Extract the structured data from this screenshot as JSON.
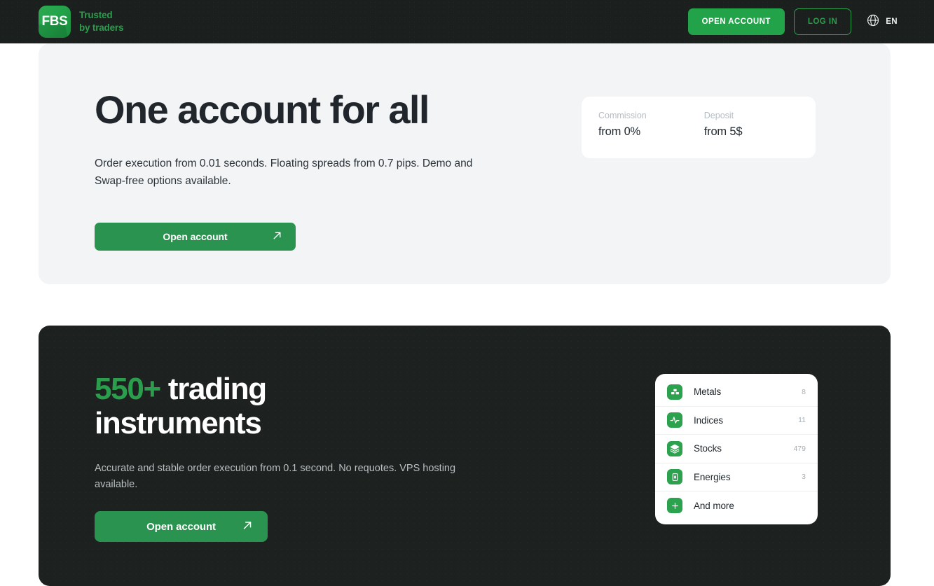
{
  "header": {
    "logo": {
      "mark_text": "FBS",
      "tagline_line1": "Trusted",
      "tagline_line2": "by traders"
    },
    "open_account_label": "OPEN ACCOUNT",
    "login_label": "LOG IN",
    "language_code": "EN"
  },
  "hero": {
    "title": "One account for all",
    "subtitle": "Order execution from 0.01 seconds. Floating spreads from 0.7 pips. Demo and Swap-free options available.",
    "cta_label": "Open account",
    "info_card": {
      "items": [
        {
          "label": "Commission",
          "value": "from 0%"
        },
        {
          "label": "Deposit",
          "value": "from 5$"
        }
      ]
    }
  },
  "instruments_section": {
    "title_accent": "550+",
    "title_rest": " trading instruments",
    "subtitle": "Accurate and stable order execution from 0.1 second. No requotes. VPS hosting available.",
    "cta_label": "Open account",
    "list": [
      {
        "icon": "metals-icon",
        "label": "Metals",
        "count": "8"
      },
      {
        "icon": "indices-icon",
        "label": "Indices",
        "count": "11"
      },
      {
        "icon": "stocks-icon",
        "label": "Stocks",
        "count": "479"
      },
      {
        "icon": "energies-icon",
        "label": "Energies",
        "count": "3"
      },
      {
        "icon": "plus-icon",
        "label": "And more",
        "count": ""
      }
    ]
  },
  "colors": {
    "brand_green": "#22a34a",
    "dark_bg": "#1d211f",
    "light_bg": "#f3f4f6"
  }
}
